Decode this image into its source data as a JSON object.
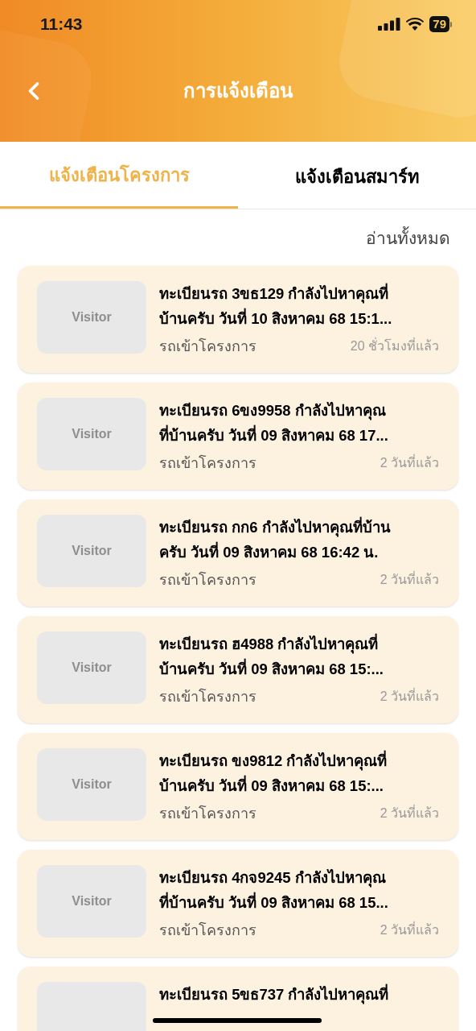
{
  "status_bar": {
    "time": "11:43",
    "battery": "79"
  },
  "header": {
    "title": "การแจ้งเตือน"
  },
  "tabs": [
    {
      "label": "แจ้งเตือนโครงการ",
      "selected": true
    },
    {
      "label": "แจ้งเตือนสมาร์ท",
      "selected": false
    }
  ],
  "mark_all_read": "อ่านทั้งหมด",
  "notifications": [
    {
      "thumbnail": "Visitor",
      "lines": [
        "ทะเบียนรถ 3ขธ129 กำลังไปหาคุณที่",
        "บ้านครับ วันที่ 10 สิงหาคม 68 15:1..."
      ],
      "category": "รถเข้าโครงการ",
      "time": "20 ชั่วโมงที่แล้ว"
    },
    {
      "thumbnail": "Visitor",
      "lines": [
        "ทะเบียนรถ 6ขง9958 กำลังไปหาคุณ",
        "ที่บ้านครับ วันที่ 09 สิงหาคม 68 17..."
      ],
      "category": "รถเข้าโครงการ",
      "time": "2 วันที่แล้ว"
    },
    {
      "thumbnail": "Visitor",
      "lines": [
        "ทะเบียนรถ กก6 กำลังไปหาคุณที่บ้าน",
        "ครับ วันที่ 09 สิงหาคม 68 16:42 น."
      ],
      "category": "รถเข้าโครงการ",
      "time": "2 วันที่แล้ว"
    },
    {
      "thumbnail": "Visitor",
      "lines": [
        "ทะเบียนรถ ฮ4988 กำลังไปหาคุณที่",
        "บ้านครับ วันที่ 09 สิงหาคม 68 15:..."
      ],
      "category": "รถเข้าโครงการ",
      "time": "2 วันที่แล้ว"
    },
    {
      "thumbnail": "Visitor",
      "lines": [
        "ทะเบียนรถ ขง9812 กำลังไปหาคุณที่",
        "บ้านครับ วันที่ 09 สิงหาคม 68 15:..."
      ],
      "category": "รถเข้าโครงการ",
      "time": "2 วันที่แล้ว"
    },
    {
      "thumbnail": "Visitor",
      "lines": [
        "ทะเบียนรถ 4กจ9245 กำลังไปหาคุณ",
        "ที่บ้านครับ วันที่ 09 สิงหาคม 68 15..."
      ],
      "category": "รถเข้าโครงการ",
      "time": "2 วันที่แล้ว"
    },
    {
      "lines": [
        "ทะเบียนรถ 5ขธ737 กำลังไปหาคุณที่"
      ]
    }
  ]
}
